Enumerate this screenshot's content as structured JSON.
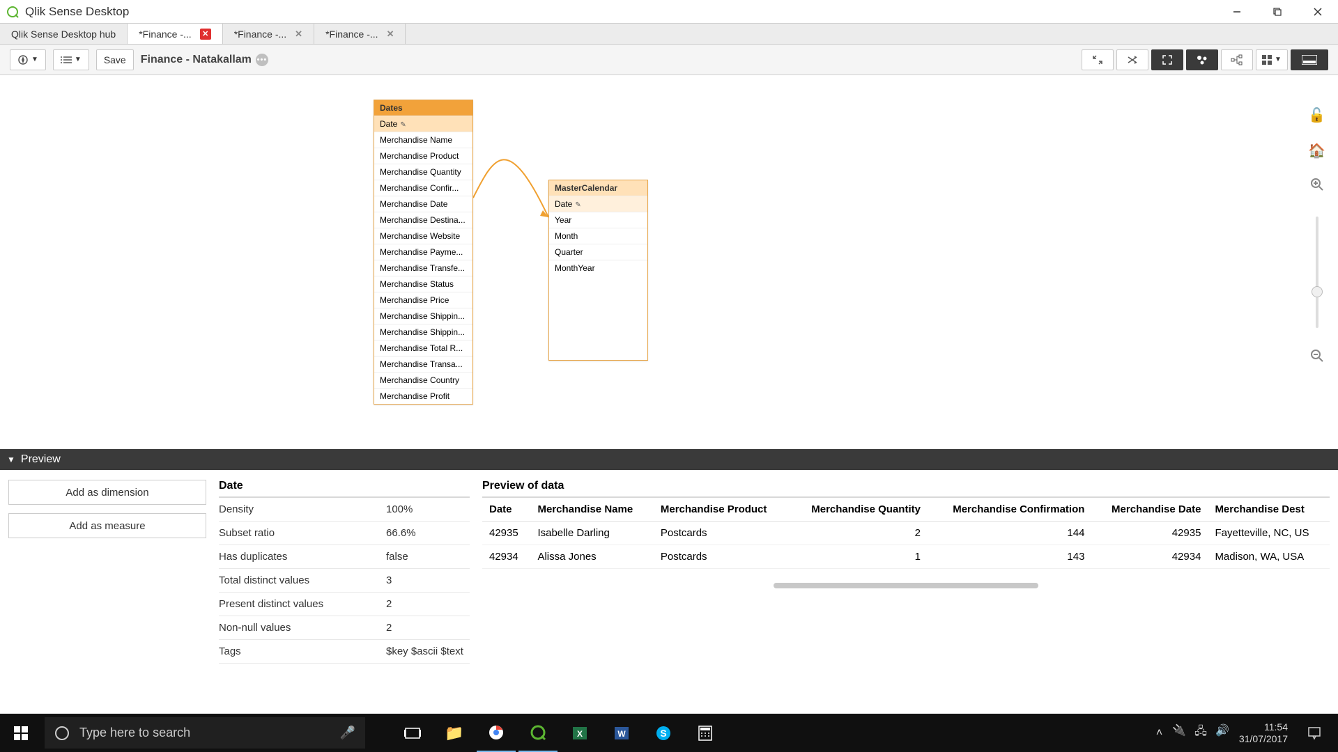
{
  "window": {
    "title": "Qlik Sense Desktop"
  },
  "tabs": [
    {
      "label": "Qlik Sense Desktop hub",
      "closable": false,
      "active": false
    },
    {
      "label": "*Finance -...",
      "closable": true,
      "active": true,
      "red": true
    },
    {
      "label": "*Finance -...",
      "closable": true,
      "active": false
    },
    {
      "label": "*Finance -...",
      "closable": true,
      "active": false
    }
  ],
  "toolbar": {
    "save_label": "Save",
    "app_title": "Finance - Natakallam"
  },
  "model": {
    "dates_table": {
      "name": "Dates",
      "key_field": "Date",
      "fields": [
        "Merchandise Name",
        "Merchandise Product",
        "Merchandise Quantity",
        "Merchandise Confir...",
        "Merchandise Date",
        "Merchandise Destina...",
        "Merchandise Website",
        "Merchandise Payme...",
        "Merchandise Transfe...",
        "Merchandise Status",
        "Merchandise Price",
        "Merchandise Shippin...",
        "Merchandise Shippin...",
        "Merchandise Total R...",
        "Merchandise Transa...",
        "Merchandise Country",
        "Merchandise Profit"
      ]
    },
    "calendar_table": {
      "name": "MasterCalendar",
      "key_field": "Date",
      "fields": [
        "Year",
        "Month",
        "Quarter",
        "MonthYear"
      ]
    }
  },
  "preview": {
    "header": "Preview",
    "actions": {
      "add_dim": "Add as dimension",
      "add_meas": "Add as measure"
    },
    "field_name": "Date",
    "stats": [
      {
        "k": "Density",
        "v": "100%"
      },
      {
        "k": "Subset ratio",
        "v": "66.6%"
      },
      {
        "k": "Has duplicates",
        "v": "false"
      },
      {
        "k": "Total distinct values",
        "v": "3"
      },
      {
        "k": "Present distinct values",
        "v": "2"
      },
      {
        "k": "Non-null values",
        "v": "2"
      },
      {
        "k": "Tags",
        "v": "$key $ascii $text"
      }
    ],
    "data_title": "Preview of data",
    "columns": [
      "Date",
      "Merchandise Name",
      "Merchandise Product",
      "Merchandise Quantity",
      "Merchandise Confirmation",
      "Merchandise Date",
      "Merchandise Dest"
    ],
    "rows": [
      {
        "date": "42935",
        "name": "Isabelle Darling",
        "product": "Postcards",
        "qty": "2",
        "conf": "144",
        "mdate": "42935",
        "dest": "Fayetteville, NC, US"
      },
      {
        "date": "42934",
        "name": "Alissa Jones",
        "product": "Postcards",
        "qty": "1",
        "conf": "143",
        "mdate": "42934",
        "dest": "Madison, WA, USA"
      }
    ]
  },
  "taskbar": {
    "search_placeholder": "Type here to search",
    "time": "11:54",
    "date": "31/07/2017"
  }
}
